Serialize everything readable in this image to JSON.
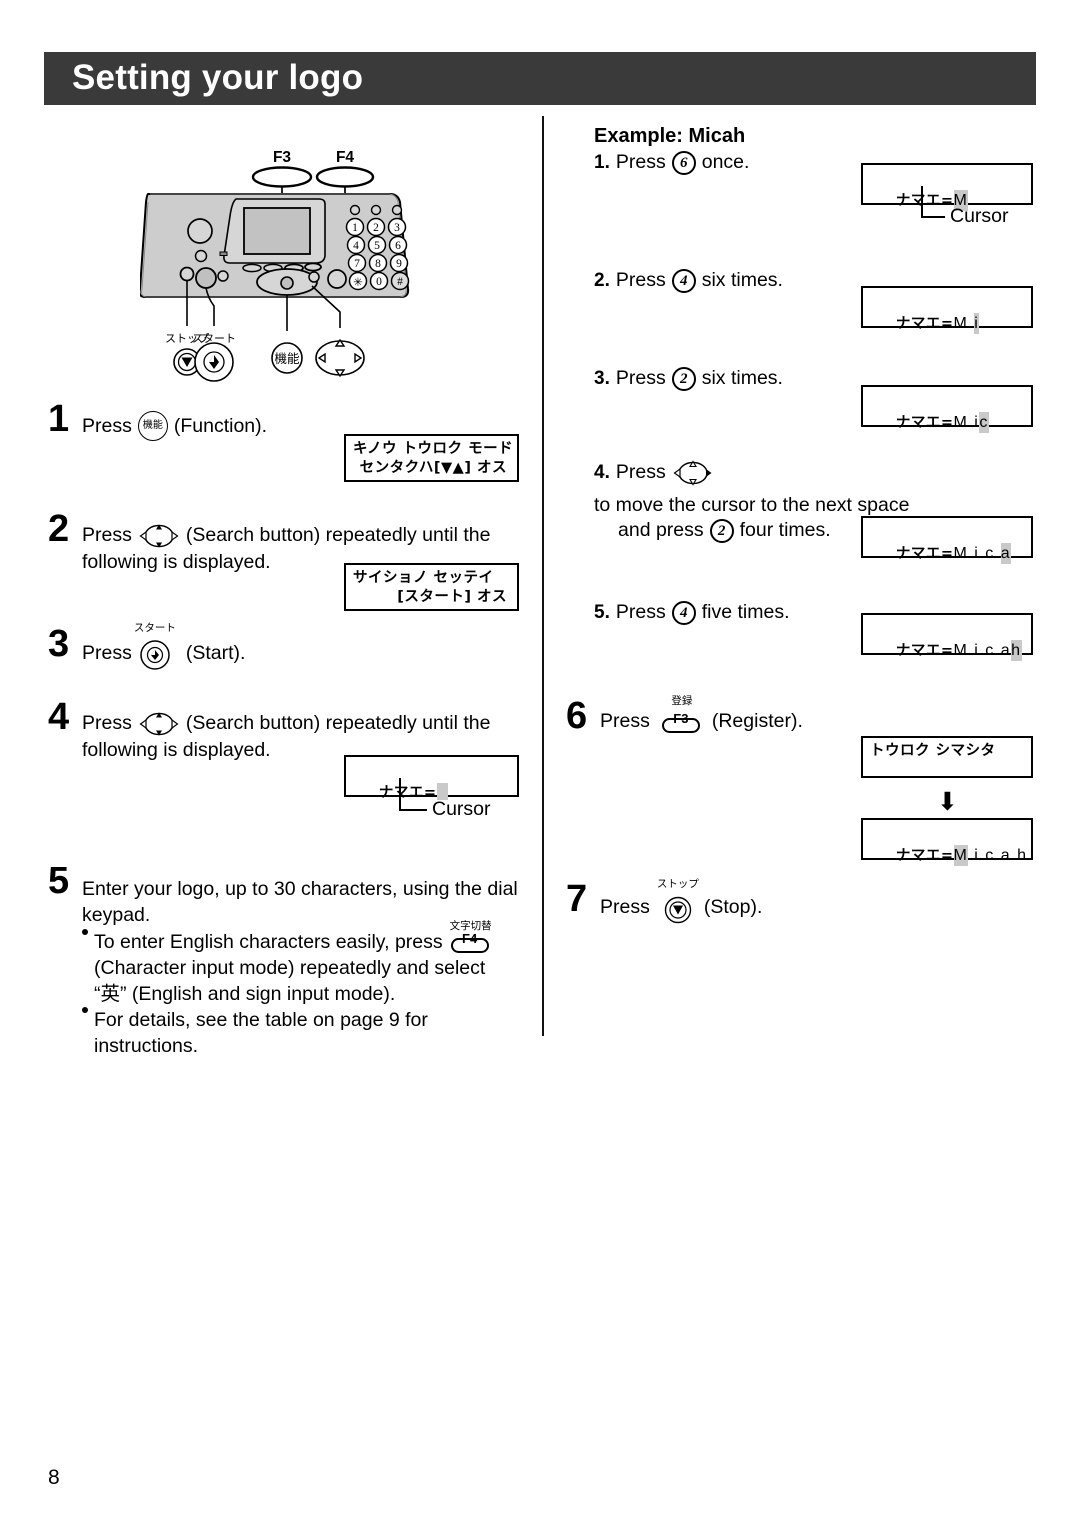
{
  "page": {
    "title": "Setting your logo",
    "page_number": "8"
  },
  "device": {
    "fkeys": [
      "F3",
      "F4"
    ],
    "keypad_digits": [
      "1",
      "2",
      "3",
      "4",
      "5",
      "6",
      "7",
      "8",
      "9",
      "*",
      "0",
      "#"
    ],
    "labels": {
      "stop": "ストップ",
      "start": "スタート",
      "function": "機能"
    }
  },
  "left_column": {
    "steps": [
      {
        "number": "1",
        "pre": "Press",
        "icon": "function-button-icon",
        "icon_label": "機能",
        "post": "(Function)."
      },
      {
        "number": "2",
        "pre": "Press",
        "icon": "search-button-icon",
        "post": "(Search button) repeatedly until the",
        "line2": "following is displayed."
      },
      {
        "number": "3",
        "pre": "Press",
        "icon": "start-button-icon",
        "icon_label": "スタート",
        "post": "(Start)."
      },
      {
        "number": "4",
        "pre": "Press",
        "icon": "search-button-icon",
        "post": "(Search button) repeatedly until the",
        "line2": "following is displayed."
      },
      {
        "number": "5",
        "line1": "Enter your logo, up to 30 characters, using the dial",
        "line2": "keypad.",
        "bullets": [
          {
            "part1": "To enter English characters easily, press",
            "icon": "f4-character-mode-key",
            "icon_jp": "文字切替",
            "icon_label": "F4",
            "part2": "(Character input mode) repeatedly and select",
            "part3": "“英” (English and sign input mode)."
          },
          {
            "part1": "For details, see the table on page 9 for instructions."
          }
        ]
      }
    ],
    "lcds": [
      {
        "line1": "キノウ トウロク モード",
        "line2": "センタクハ[▼▲] オス"
      },
      {
        "line1": "サイショノ セッテイ",
        "line2": "[スタート] オス"
      },
      {
        "prefix": "ナマエ=",
        "cursor": "",
        "suffix": ""
      }
    ],
    "cursor_label": "Cursor"
  },
  "right_column": {
    "example_title": "Example: Micah",
    "steps": [
      {
        "number": "1.",
        "pre": "Press",
        "key": "6",
        "post": "once."
      },
      {
        "number": "2.",
        "pre": "Press",
        "key": "4",
        "post": "six times."
      },
      {
        "number": "3.",
        "pre": "Press",
        "key": "2",
        "post": "six times."
      },
      {
        "number": "4.",
        "pre": "Press",
        "icon": "search-button-icon",
        "post": "to move the cursor to the next space",
        "line2_pre": "and press",
        "key": "2",
        "line2_post": "four times."
      },
      {
        "number": "5.",
        "pre": "Press",
        "key": "4",
        "post": "five times."
      },
      {
        "number": "6",
        "pre": "Press",
        "icon": "f3-register-key",
        "icon_jp": "登録",
        "icon_label": "F3",
        "post": "(Register)."
      },
      {
        "number": "7",
        "pre": "Press",
        "icon": "stop-button-icon",
        "icon_jp": "ストップ",
        "post": "(Stop)."
      }
    ],
    "lcds": [
      {
        "prefix": "ナマエ=",
        "cursor": "M",
        "suffix": ""
      },
      {
        "prefix": "ナマエ=",
        "pre_text": "M ",
        "cursor": "i",
        "suffix": ""
      },
      {
        "prefix": "ナマエ=",
        "pre_text": "M i",
        "cursor": "c",
        "suffix": ""
      },
      {
        "prefix": "ナマエ=",
        "pre_text": "M i c ",
        "cursor": "a",
        "suffix": ""
      },
      {
        "prefix": "ナマエ=",
        "pre_text": "M i c a",
        "cursor": "h",
        "suffix": ""
      },
      {
        "line1": "トウロク シマシタ"
      },
      {
        "prefix": "ナマエ=",
        "cursor": "M",
        "suffix": " i c a h"
      }
    ],
    "cursor_label": "Cursor",
    "arrow_glyph": "⬇"
  },
  "colors": {
    "header_band": "#3a3a3a",
    "header_text": "#ffffff",
    "cursor_block": "#c9c9c9",
    "device_body": "#c8c8c8",
    "ink": "#000000"
  }
}
